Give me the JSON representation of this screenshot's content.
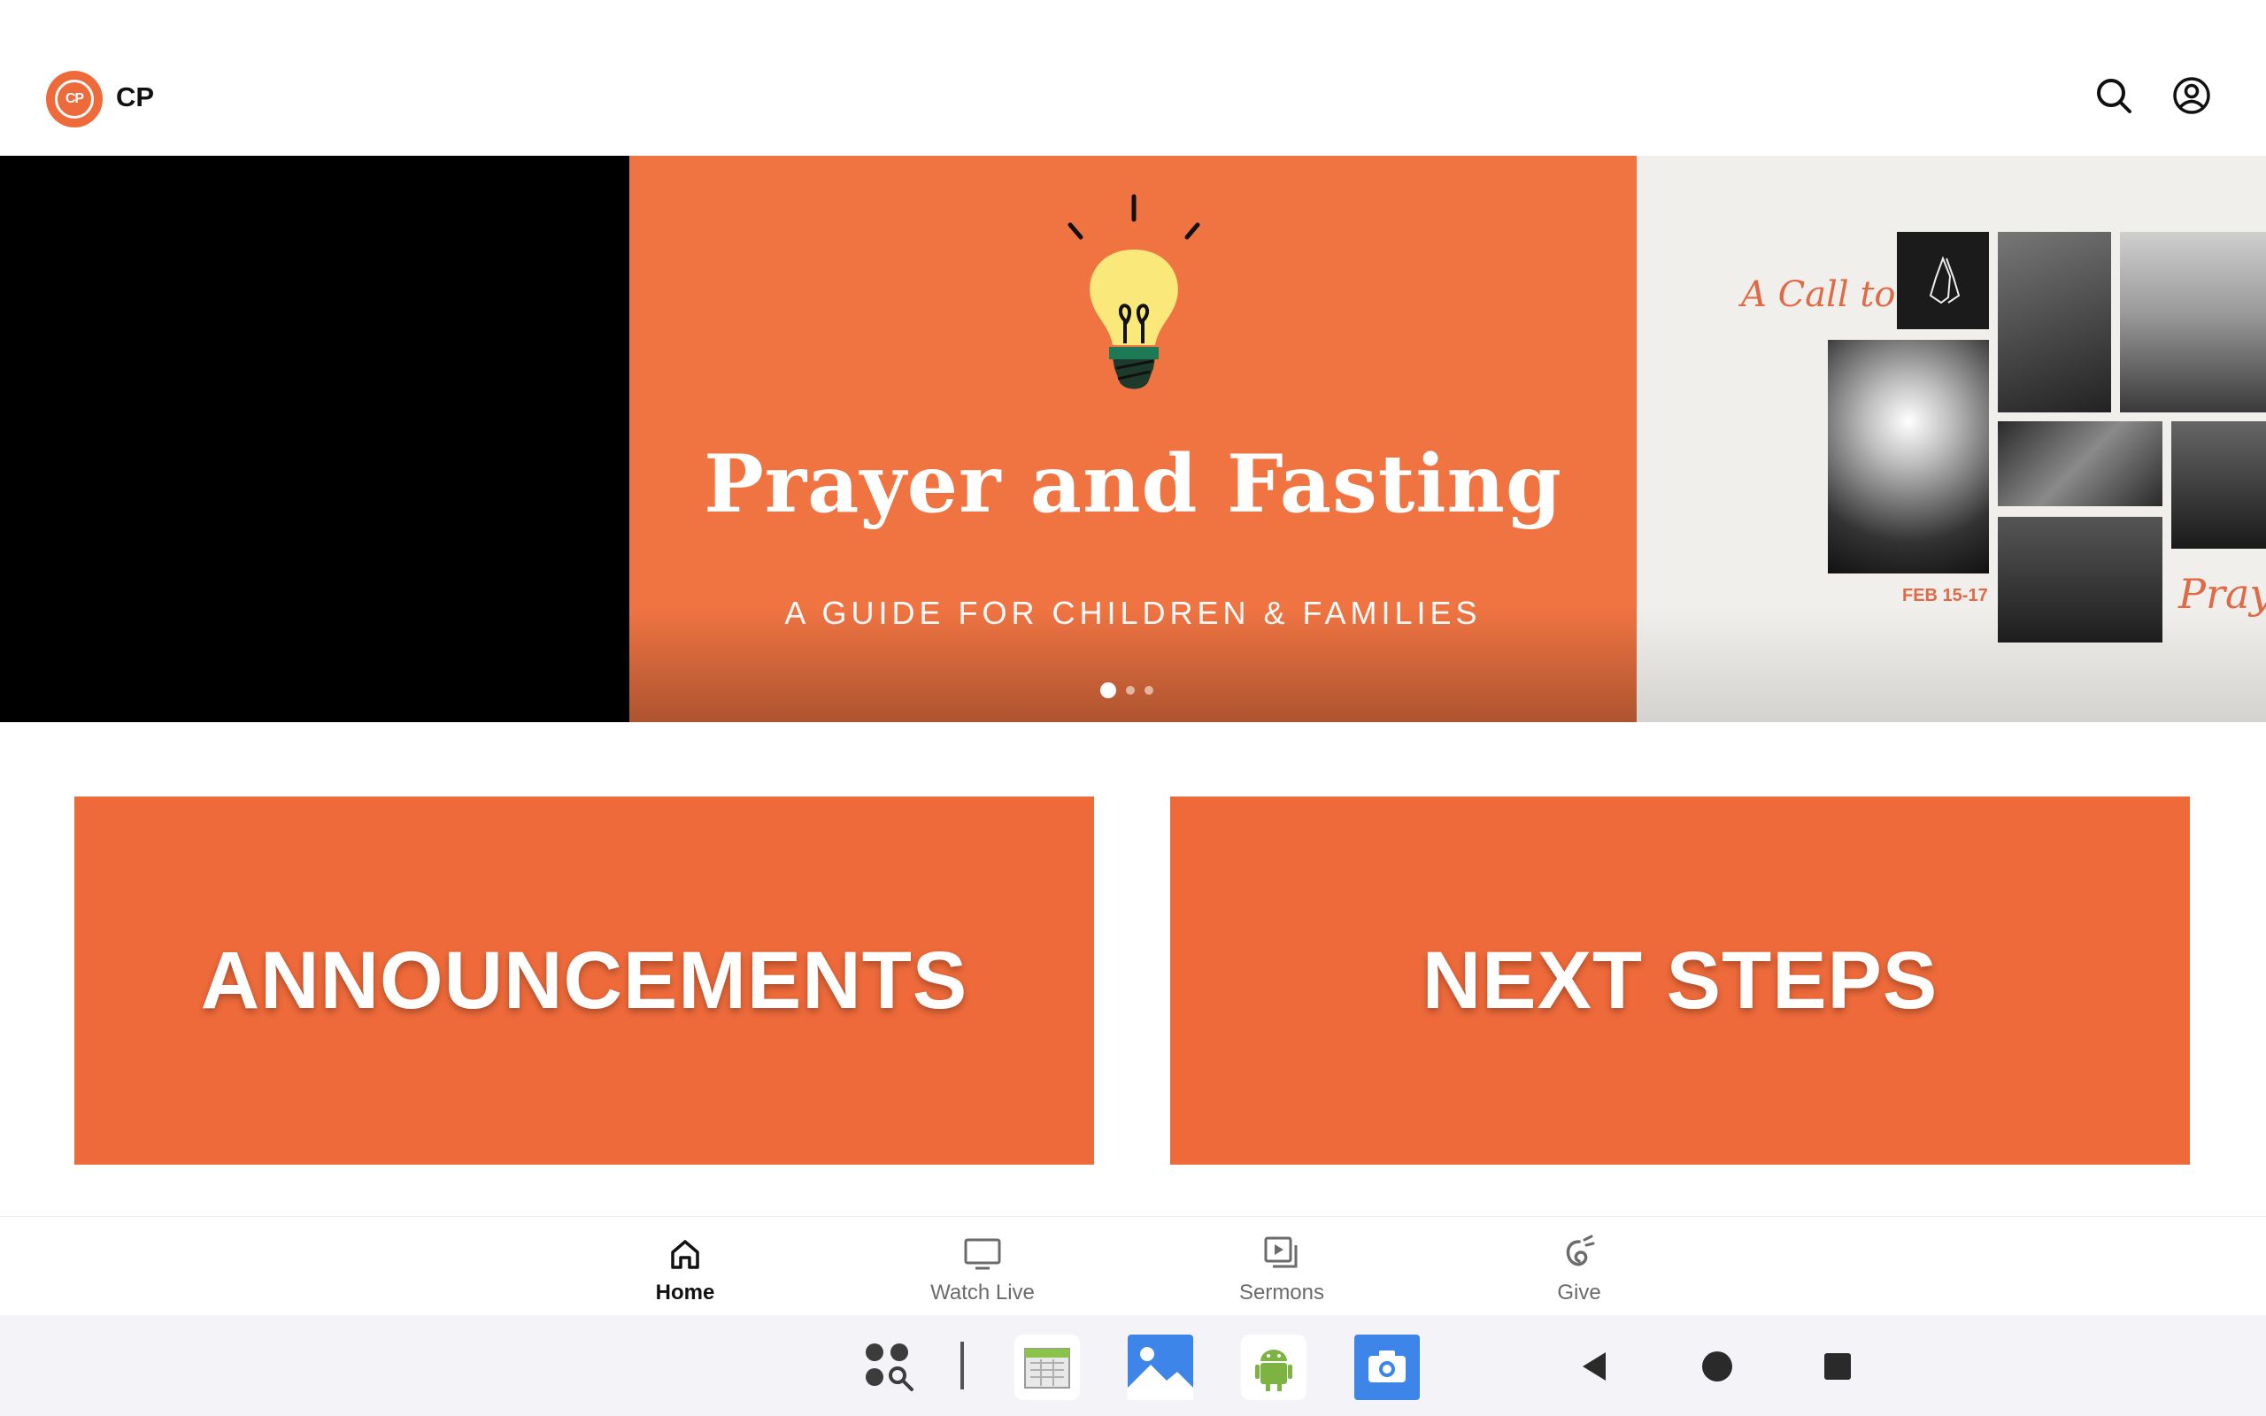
{
  "header": {
    "logo_text": "CP",
    "app_title": "CP",
    "search_icon": "search-icon",
    "account_icon": "account-circle-icon"
  },
  "carousel": {
    "current_slide": {
      "title": "Prayer and Fasting",
      "subtitle": "A GUIDE FOR CHILDREN & FAMILIES",
      "illustration": "lightbulb-icon"
    },
    "next_slide": {
      "script_heading": "A Call to",
      "script_footer": "Praye",
      "date": "FEB 15-17"
    },
    "page_count": 3,
    "active_page": 1
  },
  "tiles": [
    {
      "label": "ANNOUNCEMENTS"
    },
    {
      "label": "NEXT STEPS"
    }
  ],
  "tabbar": {
    "tabs": [
      {
        "label": "Home",
        "icon": "home-icon",
        "active": true
      },
      {
        "label": "Watch Live",
        "icon": "tv-icon",
        "active": false
      },
      {
        "label": "Sermons",
        "icon": "video-library-icon",
        "active": false
      },
      {
        "label": "Give",
        "icon": "give-icon",
        "active": false
      }
    ]
  },
  "system_bar": {
    "items": [
      "app-drawer-search-icon",
      "calendar-app-icon",
      "gallery-app-icon",
      "android-app-icon",
      "camera-app-icon",
      "back-icon",
      "home-circle-icon",
      "recents-icon"
    ]
  },
  "colors": {
    "brand_orange": "#ee6a3a",
    "hero_orange": "#f07442"
  }
}
